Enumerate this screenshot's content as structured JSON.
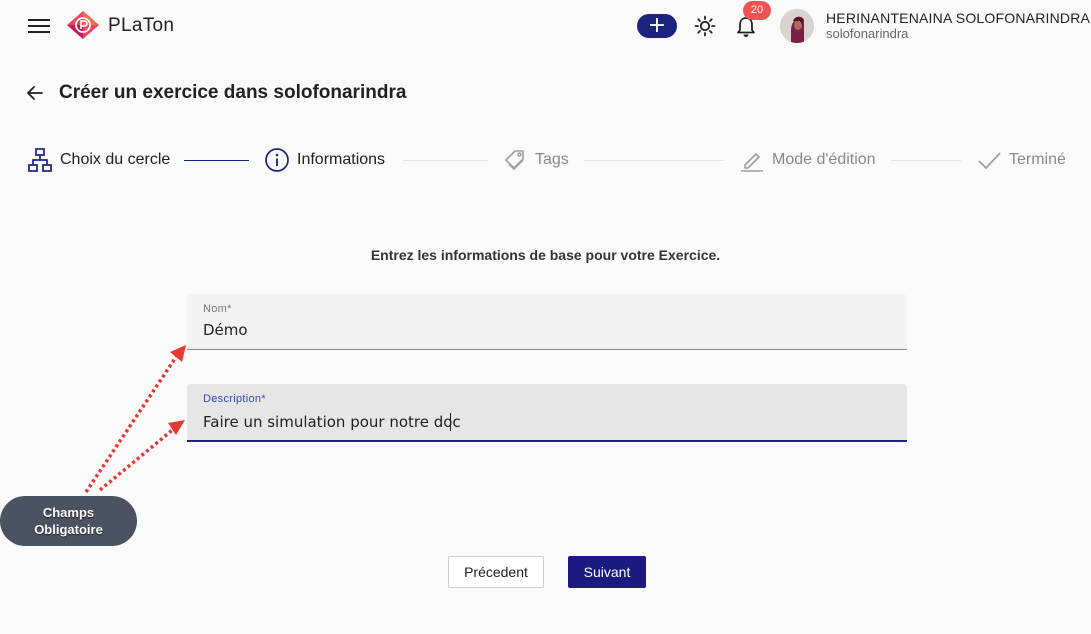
{
  "app": {
    "brand": "PLaTon",
    "notification_count": "20",
    "user_name": "HERINANTENAINA SOLOFONARINDRA",
    "user_login": "solofonarindra",
    "accent_color": "#1a237e",
    "badge_color": "#ef5350"
  },
  "page": {
    "title": "Créer un exercice dans solofonarindra"
  },
  "stepper": {
    "steps": [
      {
        "label": "Choix du cercle",
        "icon": "sitemap-icon",
        "state": "done"
      },
      {
        "label": "Informations",
        "icon": "info-icon",
        "state": "current"
      },
      {
        "label": "Tags",
        "icon": "tag-icon",
        "state": "pending"
      },
      {
        "label": "Mode d'édition",
        "icon": "pencil-icon",
        "state": "pending"
      },
      {
        "label": "Terminé",
        "icon": "check-icon",
        "state": "pending"
      }
    ]
  },
  "form": {
    "intro": "Entrez les informations de base pour votre Exercice.",
    "nom_label": "Nom*",
    "nom_value": "Démo",
    "description_label": "Description*",
    "description_value": "Faire un simulation pour notre doc"
  },
  "annotation": {
    "line1": "Champs",
    "line2": "Obligatoire",
    "color": "#e53935"
  },
  "actions": {
    "previous": "Précedent",
    "next": "Suivant"
  }
}
